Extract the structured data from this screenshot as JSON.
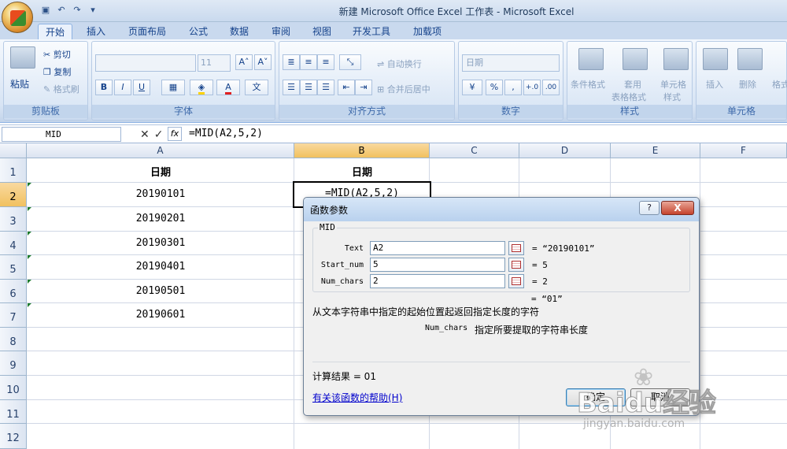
{
  "window": {
    "title": "新建 Microsoft Office Excel 工作表 - Microsoft Excel"
  },
  "tabs": [
    "开始",
    "插入",
    "页面布局",
    "公式",
    "数据",
    "审阅",
    "视图",
    "开发工具",
    "加载项"
  ],
  "ribbon": {
    "clipboard": {
      "label": "剪贴板",
      "paste": "粘贴",
      "cut": "剪切",
      "copy": "复制",
      "painter": "格式刷"
    },
    "font": {
      "label": "字体",
      "size": "11",
      "grow": "A˄",
      "shrink": "A˅",
      "bold": "B",
      "italic": "I",
      "underline": "U"
    },
    "alignment": {
      "label": "对齐方式",
      "wrap": "自动换行",
      "merge": "合并后居中"
    },
    "number": {
      "label": "数字",
      "format": "日期",
      "percent": "%",
      "comma": ",",
      "increase": "+.0",
      "decrease": ".00"
    },
    "styles": {
      "label": "样式",
      "cond": "条件格式",
      "table1": "套用",
      "table2": "表格格式",
      "cell1": "单元格",
      "cell2": "样式"
    },
    "cells": {
      "label": "单元格",
      "insert": "插入",
      "delete": "删除",
      "format": "格式"
    }
  },
  "formula_bar": {
    "name_box": "MID",
    "fx": "fx",
    "formula": "=MID(A2,5,2)"
  },
  "sheet": {
    "columns": [
      "A",
      "B",
      "C",
      "D",
      "E",
      "F"
    ],
    "rows": [
      "1",
      "2",
      "3",
      "4",
      "5",
      "6",
      "7",
      "8",
      "9",
      "10",
      "11",
      "12"
    ],
    "header_a": "日期",
    "header_b": "日期",
    "values_a": [
      "20190101",
      "20190201",
      "20190301",
      "20190401",
      "20190501",
      "20190601"
    ],
    "active_cell_text": "=MID(A2,5,2)"
  },
  "dialog": {
    "title": "函数参数",
    "help_btn": "?",
    "close_btn": "X",
    "function_name": "MID",
    "args": [
      {
        "label": "Text",
        "value": "A2",
        "result": "= “20190101”"
      },
      {
        "label": "Start_num",
        "value": "5",
        "result": "= 5"
      },
      {
        "label": "Num_chars",
        "value": "2",
        "result": "= 2"
      }
    ],
    "overall_result": "= “01”",
    "description": "从文本字符串中指定的起始位置起返回指定长度的字符",
    "arg_desc_name": "Num_chars",
    "arg_desc": "指定所要提取的字符串长度",
    "calc_result": "计算结果 =  01",
    "help_link": "有关该函数的帮助(H)",
    "ok": "确定",
    "cancel": "取消"
  },
  "watermark": {
    "text": "Baidu经验",
    "url": "jingyan.baidu.com"
  }
}
